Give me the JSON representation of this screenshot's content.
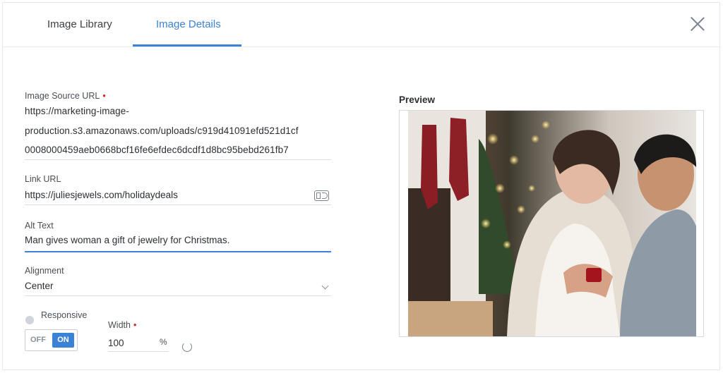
{
  "tabs": [
    {
      "label": "Image Library"
    },
    {
      "label": "Image Details"
    }
  ],
  "form": {
    "source": {
      "label": "Image Source URL",
      "required": "•",
      "lines": [
        "https://marketing-image-",
        "production.s3.amazonaws.com/uploads/c919d41091efd521d1cf",
        "0008000459aeb0668bcf16fe6efdec6dcdf1d8bc95bebd261fb7"
      ]
    },
    "link": {
      "label": "Link URL",
      "value": "https://juliesjewels.com/holidaydeals"
    },
    "alt": {
      "label": "Alt Text",
      "value": "Man gives woman a gift of jewelry for Christmas."
    },
    "alignment": {
      "label": "Alignment",
      "value": "Center"
    },
    "responsive": {
      "label": "Responsive",
      "off": "OFF",
      "on": "ON"
    },
    "width": {
      "label": "Width",
      "required": "•",
      "value": "100",
      "unit": "%"
    }
  },
  "preview": {
    "title": "Preview"
  },
  "colors": {
    "accent": "#3b82d6",
    "required": "#c62828"
  },
  "icons": [
    "close-icon",
    "link-preview-icon",
    "chevron-down-icon",
    "refresh-icon"
  ]
}
